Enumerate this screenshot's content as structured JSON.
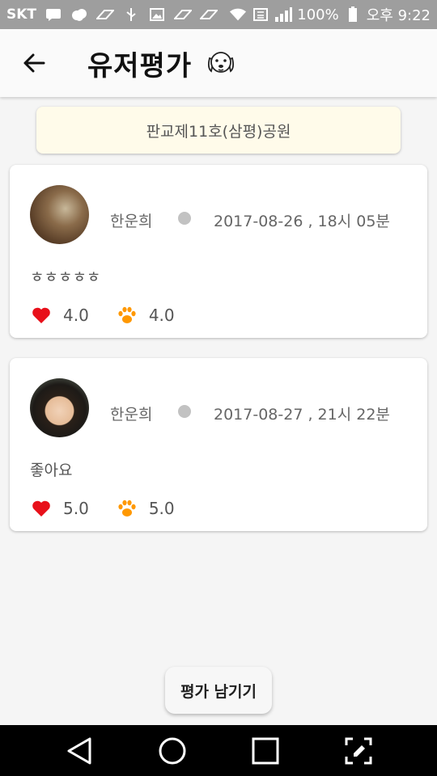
{
  "status_bar": {
    "carrier": "SKT",
    "battery": "100%",
    "time": "오후 9:22"
  },
  "header": {
    "title": "유저평가",
    "logo_icon": "dog-face-icon"
  },
  "park": {
    "name": "판교제11호(삼평)공원"
  },
  "reviews": [
    {
      "user": "한운희",
      "datetime": "2017-08-26 , 18시 05분",
      "comment": "ㅎㅎㅎㅎㅎ",
      "heart_score": "4.0",
      "paw_score": "4.0"
    },
    {
      "user": "한운희",
      "datetime": "2017-08-27 , 21시 22분",
      "comment": "좋아요",
      "heart_score": "5.0",
      "paw_score": "5.0"
    }
  ],
  "actions": {
    "write_review": "평가 남기기"
  },
  "colors": {
    "heart": "#e8101a",
    "paw": "#ff9800",
    "banner_bg": "#fffbea"
  }
}
